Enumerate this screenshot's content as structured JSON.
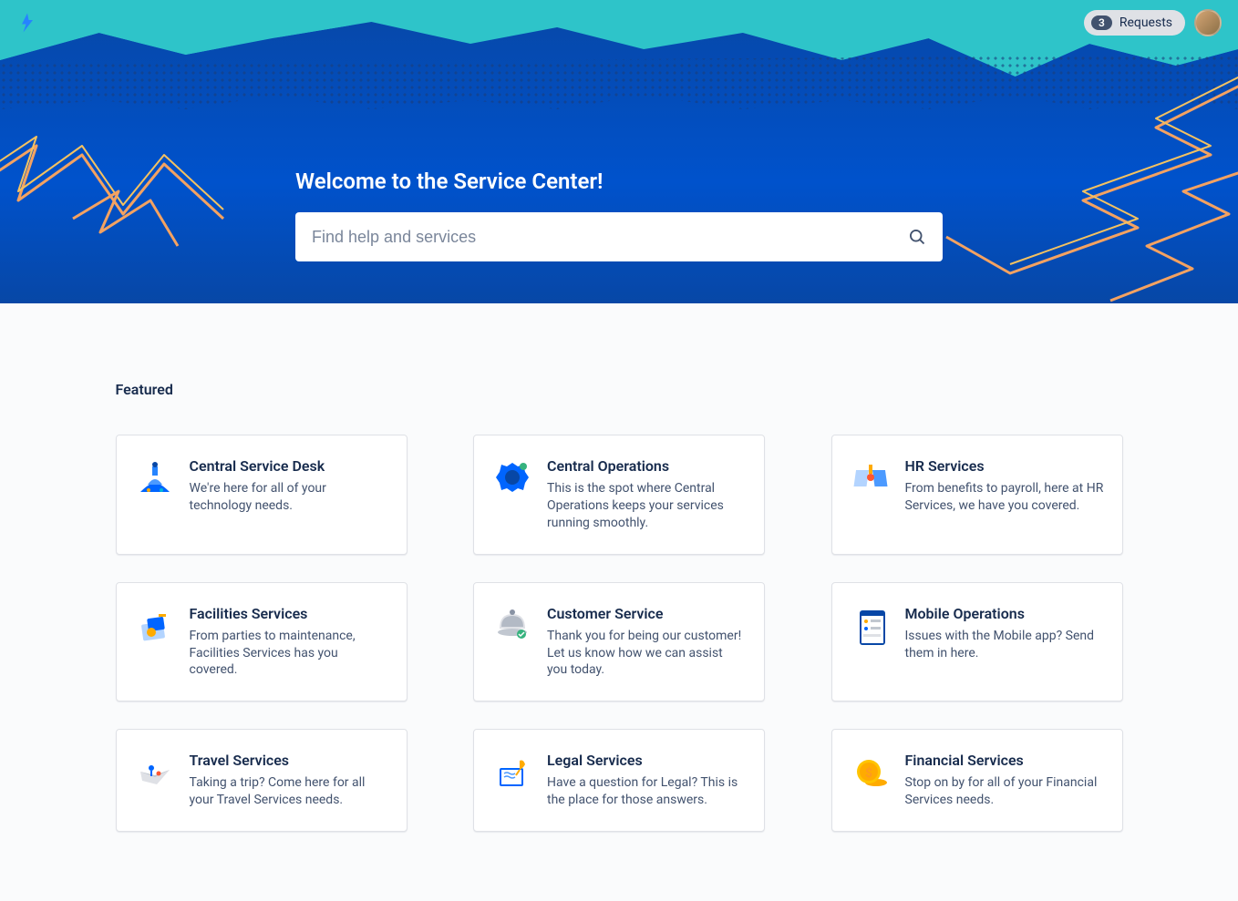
{
  "header": {
    "requests_count": "3",
    "requests_label": "Requests"
  },
  "hero": {
    "title": "Welcome to the Service Center!",
    "search_placeholder": "Find help and services"
  },
  "featured": {
    "title": "Featured",
    "cards": [
      {
        "title": "Central Service Desk",
        "description": "We're here for all of your technology needs."
      },
      {
        "title": "Central Operations",
        "description": "This is the spot where Central Operations keeps your services running smoothly."
      },
      {
        "title": "HR Services",
        "description": "From benefits to payroll, here at HR Services, we have you covered."
      },
      {
        "title": "Facilities Services",
        "description": "From parties to maintenance, Facilities Services has you covered."
      },
      {
        "title": "Customer Service",
        "description": "Thank you for being our customer! Let us know how we can assist you today."
      },
      {
        "title": "Mobile Operations",
        "description": "Issues with the Mobile app? Send them in here."
      },
      {
        "title": "Travel Services",
        "description": "Taking a trip? Come here for all your Travel Services needs."
      },
      {
        "title": "Legal Services",
        "description": "Have a question for Legal? This is the place for those answers."
      },
      {
        "title": "Financial Services",
        "description": "Stop on by for all of your Financial Services needs."
      }
    ]
  }
}
